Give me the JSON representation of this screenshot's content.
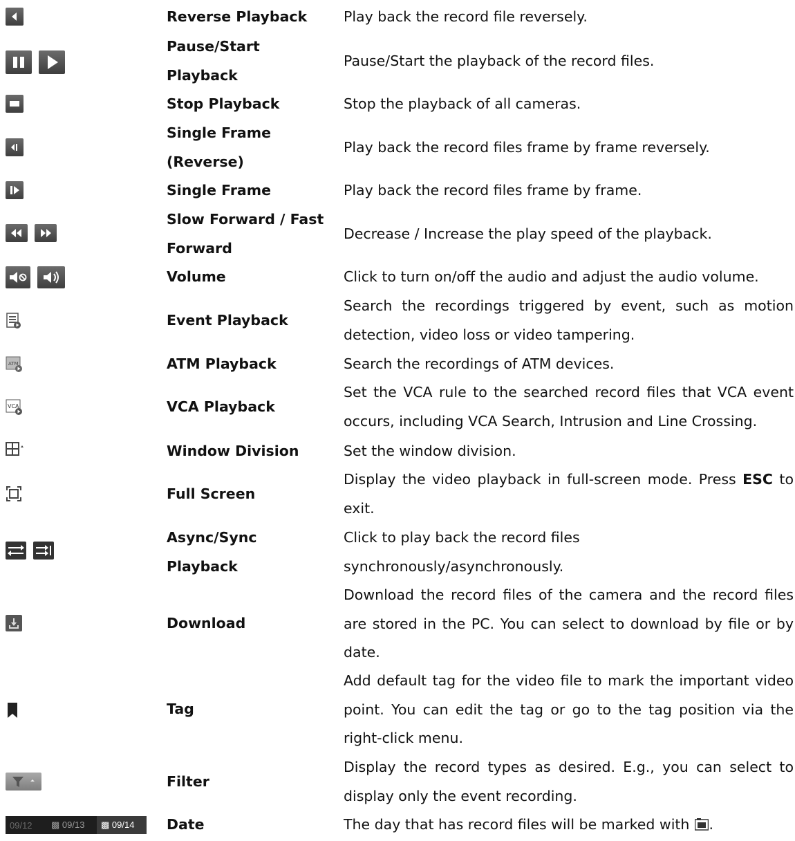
{
  "rows": [
    {
      "name": "Reverse Playback",
      "desc": "Play back the record file reversely.",
      "icons": [
        "reverse-playback-icon"
      ]
    },
    {
      "name_lines": [
        "Pause/Start",
        "Playback"
      ],
      "desc": "Pause/Start the playback of the record files.",
      "icons": [
        "pause-icon",
        "play-icon"
      ]
    },
    {
      "name": "Stop Playback",
      "desc": "Stop the playback of all cameras.",
      "icons": [
        "stop-icon"
      ]
    },
    {
      "name_lines": [
        "Single Frame",
        "(Reverse)"
      ],
      "desc": "Play back the record files frame by frame reversely.",
      "icons": [
        "single-frame-reverse-icon"
      ]
    },
    {
      "name": "Single Frame",
      "desc": "Play back the record files frame by frame.",
      "icons": [
        "single-frame-icon"
      ]
    },
    {
      "name_lines": [
        "Slow Forward / Fast",
        "Forward"
      ],
      "desc": "Decrease / Increase the play speed of the playback.",
      "icons": [
        "slow-forward-icon",
        "fast-forward-icon"
      ]
    },
    {
      "name": "Volume",
      "desc": "Click to turn on/off the audio and adjust the audio volume.",
      "icons": [
        "mute-icon",
        "volume-icon"
      ]
    },
    {
      "name": "Event Playback",
      "desc": "Search the recordings triggered by event, such as motion detection, video loss or video tampering.",
      "icons": [
        "event-playback-icon"
      ]
    },
    {
      "name": "ATM Playback",
      "desc": "Search the recordings of ATM devices.",
      "icons": [
        "atm-playback-icon"
      ]
    },
    {
      "name": "VCA Playback",
      "desc": "Set the VCA rule to the searched record files that VCA event occurs, including VCA Search, Intrusion and Line Crossing.",
      "icons": [
        "vca-playback-icon"
      ]
    },
    {
      "name": "Window Division",
      "desc": "Set the window division.",
      "icons": [
        "window-division-icon"
      ]
    },
    {
      "name": "Full Screen",
      "desc_parts": [
        "Display the video playback in full-screen mode. Press ",
        "ESC",
        " to exit."
      ],
      "icons": [
        "full-screen-icon"
      ]
    },
    {
      "name_lines": [
        "Async/Sync",
        "Playback"
      ],
      "desc_lines": [
        "Click to play back the record files",
        "synchronously/asynchronously."
      ],
      "icons": [
        "async-playback-icon",
        "sync-playback-icon"
      ]
    },
    {
      "name": "Download",
      "desc": "Download the record files of the camera and the record files are stored in the PC. You can select to download by file or by date.",
      "icons": [
        "download-icon"
      ]
    },
    {
      "name": "Tag",
      "desc": "Add default tag for the video file to mark the important video point. You can edit the tag or go to the tag position via the right-click menu.",
      "icons": [
        "tag-icon"
      ]
    },
    {
      "name": "Filter",
      "desc": "Display the record types as desired. E.g., you can select to display only the event recording.",
      "icons": [
        "filter-icon"
      ]
    },
    {
      "name": "Date",
      "desc": "The day that has record files will be marked with",
      "desc_end": ".",
      "icons": [
        "date-bar",
        "record-marker-icon"
      ],
      "dates": [
        "09/12",
        "09/13",
        "09/14"
      ]
    }
  ],
  "colors": {
    "icon_dark": "#4a4a4a",
    "icon_light": "#9a9a9a",
    "date_bar": "#1e1e1e"
  }
}
